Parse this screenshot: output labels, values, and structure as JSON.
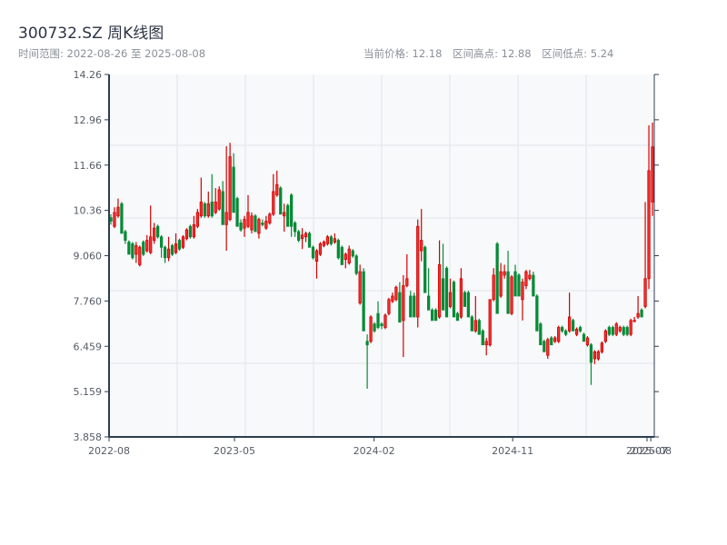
{
  "header": {
    "title": "300732.SZ 周K线图",
    "range_label": "时间范围: 2022-08-26 至 2025-08-08",
    "current_price": "当前价格: 12.18",
    "range_high": "区间高点: 12.88",
    "range_low": "区间低点: 5.24"
  },
  "colors": {
    "up": "#d40000",
    "up_fill": "#ee3333",
    "down": "#078a36",
    "plot_bg": "#f7f9fb",
    "axis": "#2c3e50",
    "grid": "#e2e5ea"
  },
  "chart_data": {
    "type": "candlestick",
    "title": "",
    "xlabel": "",
    "ylabel": "",
    "start_date": "2022-08-26",
    "end_date": "2025-08-08",
    "ylim": [
      3.858,
      14.26
    ],
    "y_ticks": [
      "14.26",
      "12.96",
      "11.66",
      "10.36",
      "9.060",
      "7.760",
      "6.459",
      "5.159",
      "3.858"
    ],
    "x_ticks": [
      "2022-08",
      "2023-05",
      "2024-02",
      "2024-11",
      "2025-07",
      "2025-08"
    ],
    "grid": true,
    "ohlc_fields": [
      "open",
      "high",
      "low",
      "close"
    ],
    "candles": [
      [
        10.15,
        10.25,
        9.95,
        10.05
      ],
      [
        9.9,
        10.45,
        9.85,
        10.3
      ],
      [
        10.2,
        10.7,
        10.15,
        10.45
      ],
      [
        10.55,
        10.6,
        9.7,
        9.7
      ],
      [
        9.75,
        9.8,
        9.4,
        9.5
      ],
      [
        9.45,
        9.5,
        9.1,
        9.1
      ],
      [
        9.4,
        9.45,
        8.95,
        9.0
      ],
      [
        9.1,
        9.45,
        8.85,
        9.35
      ],
      [
        8.8,
        9.35,
        8.75,
        9.3
      ],
      [
        9.45,
        9.5,
        9.05,
        9.1
      ],
      [
        9.2,
        9.65,
        9.15,
        9.5
      ],
      [
        9.15,
        10.5,
        9.1,
        9.6
      ],
      [
        9.5,
        10.0,
        9.4,
        9.85
      ],
      [
        9.9,
        9.95,
        9.55,
        9.6
      ],
      [
        9.6,
        9.65,
        9.0,
        9.3
      ],
      [
        9.3,
        9.35,
        8.85,
        9.0
      ],
      [
        9.0,
        9.6,
        8.9,
        9.25
      ],
      [
        9.35,
        9.4,
        9.05,
        9.1
      ],
      [
        9.15,
        9.7,
        9.1,
        9.4
      ],
      [
        9.5,
        9.55,
        9.2,
        9.25
      ],
      [
        9.3,
        9.65,
        9.25,
        9.6
      ],
      [
        9.55,
        9.85,
        9.5,
        9.8
      ],
      [
        9.9,
        9.95,
        9.55,
        9.6
      ],
      [
        9.6,
        10.2,
        9.55,
        9.95
      ],
      [
        9.9,
        10.4,
        9.85,
        10.3
      ],
      [
        10.2,
        11.3,
        10.15,
        10.6
      ],
      [
        10.55,
        10.6,
        10.15,
        10.2
      ],
      [
        10.2,
        10.9,
        10.15,
        10.55
      ],
      [
        10.6,
        11.4,
        10.15,
        10.2
      ],
      [
        10.3,
        11.0,
        10.25,
        10.6
      ],
      [
        10.4,
        11.05,
        10.35,
        10.95
      ],
      [
        10.9,
        11.2,
        9.95,
        9.95
      ],
      [
        9.95,
        12.2,
        9.2,
        10.3
      ],
      [
        10.1,
        12.3,
        10.05,
        11.9
      ],
      [
        11.6,
        12.0,
        10.3,
        10.3
      ],
      [
        10.7,
        10.75,
        9.9,
        9.9
      ],
      [
        10.0,
        10.1,
        9.75,
        9.8
      ],
      [
        9.85,
        10.2,
        9.6,
        10.1
      ],
      [
        9.9,
        10.8,
        9.85,
        10.3
      ],
      [
        9.8,
        10.3,
        9.7,
        10.2
      ],
      [
        10.2,
        10.25,
        9.75,
        9.75
      ],
      [
        9.7,
        10.15,
        9.55,
        10.1
      ],
      [
        10.0,
        10.1,
        9.9,
        9.95
      ],
      [
        9.85,
        10.2,
        9.8,
        10.05
      ],
      [
        10.0,
        10.3,
        9.95,
        10.25
      ],
      [
        10.25,
        11.4,
        10.2,
        10.9
      ],
      [
        10.8,
        11.5,
        10.75,
        11.1
      ],
      [
        11.0,
        11.05,
        10.25,
        10.25
      ],
      [
        10.2,
        10.55,
        9.75,
        10.3
      ],
      [
        10.5,
        10.55,
        9.9,
        9.9
      ],
      [
        10.8,
        10.85,
        9.6,
        9.9
      ],
      [
        10.0,
        10.05,
        9.6,
        9.75
      ],
      [
        9.75,
        9.8,
        9.45,
        9.5
      ],
      [
        9.55,
        9.85,
        9.25,
        9.65
      ],
      [
        9.6,
        9.75,
        9.45,
        9.7
      ],
      [
        9.7,
        9.75,
        9.3,
        9.3
      ],
      [
        9.3,
        9.35,
        8.95,
        9.0
      ],
      [
        8.9,
        9.25,
        8.4,
        9.2
      ],
      [
        9.1,
        9.45,
        9.05,
        9.4
      ],
      [
        9.35,
        9.5,
        9.3,
        9.45
      ],
      [
        9.4,
        9.65,
        9.35,
        9.6
      ],
      [
        9.6,
        9.65,
        9.35,
        9.4
      ],
      [
        9.45,
        9.7,
        9.4,
        9.55
      ],
      [
        9.5,
        9.55,
        8.95,
        9.0
      ],
      [
        9.3,
        9.35,
        8.8,
        8.8
      ],
      [
        8.95,
        9.15,
        8.7,
        9.1
      ],
      [
        8.85,
        9.35,
        8.8,
        9.25
      ],
      [
        9.2,
        9.25,
        9.0,
        9.05
      ],
      [
        9.05,
        9.1,
        8.5,
        8.55
      ],
      [
        7.7,
        8.8,
        7.65,
        8.6
      ],
      [
        8.6,
        8.7,
        6.9,
        6.9
      ],
      [
        6.6,
        6.8,
        5.24,
        6.5
      ],
      [
        6.6,
        7.35,
        6.55,
        7.3
      ],
      [
        7.1,
        7.15,
        6.85,
        6.9
      ],
      [
        7.4,
        7.75,
        6.95,
        7.0
      ],
      [
        7.1,
        7.15,
        6.95,
        7.05
      ],
      [
        7.0,
        7.4,
        6.95,
        7.35
      ],
      [
        7.4,
        7.85,
        7.35,
        7.8
      ],
      [
        7.75,
        8.0,
        7.7,
        7.9
      ],
      [
        7.8,
        8.2,
        7.75,
        8.15
      ],
      [
        8.0,
        8.3,
        7.15,
        7.15
      ],
      [
        7.2,
        8.5,
        6.15,
        8.2
      ],
      [
        8.2,
        9.1,
        8.15,
        8.4
      ],
      [
        7.9,
        8.05,
        7.3,
        7.3
      ],
      [
        7.9,
        8.0,
        7.3,
        7.3
      ],
      [
        7.3,
        10.1,
        7.0,
        9.9
      ],
      [
        9.2,
        10.4,
        8.9,
        9.5
      ],
      [
        9.3,
        9.35,
        8.0,
        8.0
      ],
      [
        7.9,
        8.7,
        7.5,
        7.5
      ],
      [
        7.5,
        7.55,
        7.2,
        7.2
      ],
      [
        7.5,
        7.55,
        7.2,
        7.2
      ],
      [
        7.3,
        9.5,
        7.25,
        8.8
      ],
      [
        8.4,
        9.4,
        7.5,
        7.5
      ],
      [
        8.7,
        8.75,
        7.3,
        7.3
      ],
      [
        7.6,
        8.4,
        7.55,
        8.0
      ],
      [
        8.3,
        8.35,
        7.3,
        7.3
      ],
      [
        7.4,
        7.45,
        7.2,
        7.2
      ],
      [
        7.3,
        8.7,
        7.25,
        8.4
      ],
      [
        8.0,
        8.05,
        7.6,
        7.6
      ],
      [
        8.0,
        8.05,
        7.3,
        7.3
      ],
      [
        7.3,
        7.35,
        6.9,
        6.9
      ],
      [
        6.9,
        7.9,
        6.85,
        7.2
      ],
      [
        7.2,
        7.25,
        6.8,
        6.8
      ],
      [
        6.9,
        6.95,
        6.5,
        6.5
      ],
      [
        6.5,
        6.7,
        6.2,
        6.6
      ],
      [
        6.5,
        7.8,
        6.45,
        7.8
      ],
      [
        7.8,
        8.7,
        7.75,
        8.5
      ],
      [
        9.4,
        9.45,
        7.4,
        7.4
      ],
      [
        7.9,
        8.85,
        7.85,
        8.6
      ],
      [
        8.5,
        8.8,
        8.4,
        8.6
      ],
      [
        8.6,
        9.2,
        7.4,
        7.4
      ],
      [
        7.4,
        8.5,
        7.35,
        8.45
      ],
      [
        8.6,
        8.8,
        7.9,
        7.9
      ],
      [
        8.5,
        8.55,
        7.9,
        7.9
      ],
      [
        7.8,
        8.4,
        7.2,
        8.3
      ],
      [
        8.2,
        8.65,
        8.1,
        8.6
      ],
      [
        8.4,
        8.65,
        8.35,
        8.5
      ],
      [
        8.5,
        8.6,
        7.9,
        7.9
      ],
      [
        7.9,
        7.95,
        6.9,
        6.9
      ],
      [
        7.1,
        7.15,
        6.5,
        6.5
      ],
      [
        6.6,
        6.65,
        6.3,
        6.3
      ],
      [
        6.2,
        6.7,
        6.1,
        6.65
      ],
      [
        6.7,
        6.75,
        6.5,
        6.5
      ],
      [
        6.6,
        6.75,
        6.55,
        6.7
      ],
      [
        6.6,
        7.05,
        6.55,
        7.0
      ],
      [
        7.0,
        7.05,
        6.85,
        6.9
      ],
      [
        6.9,
        6.95,
        6.75,
        6.8
      ],
      [
        6.9,
        8.0,
        6.85,
        7.3
      ],
      [
        7.2,
        7.25,
        6.9,
        6.9
      ],
      [
        6.8,
        7.0,
        6.75,
        6.95
      ],
      [
        7.0,
        7.05,
        6.85,
        6.9
      ],
      [
        6.8,
        6.85,
        6.6,
        6.6
      ],
      [
        6.5,
        6.75,
        6.45,
        6.7
      ],
      [
        6.5,
        6.55,
        5.35,
        6.0
      ],
      [
        6.1,
        6.35,
        5.95,
        6.3
      ],
      [
        6.1,
        6.35,
        6.05,
        6.3
      ],
      [
        6.3,
        6.6,
        6.25,
        6.55
      ],
      [
        6.6,
        6.95,
        6.55,
        6.9
      ],
      [
        7.0,
        7.05,
        6.75,
        6.8
      ],
      [
        7.0,
        7.05,
        6.75,
        6.8
      ],
      [
        6.8,
        7.15,
        6.75,
        7.1
      ],
      [
        6.9,
        7.05,
        6.85,
        7.0
      ],
      [
        7.0,
        7.05,
        6.75,
        6.8
      ],
      [
        7.0,
        7.05,
        6.75,
        6.8
      ],
      [
        6.8,
        7.25,
        6.75,
        7.2
      ],
      [
        7.2,
        7.3,
        7.15,
        7.2
      ],
      [
        7.3,
        7.9,
        7.25,
        7.4
      ],
      [
        7.5,
        7.55,
        7.3,
        7.3
      ],
      [
        7.6,
        10.6,
        7.55,
        8.4
      ],
      [
        8.4,
        12.8,
        8.1,
        11.5
      ],
      [
        10.6,
        12.88,
        10.2,
        12.18
      ]
    ]
  }
}
